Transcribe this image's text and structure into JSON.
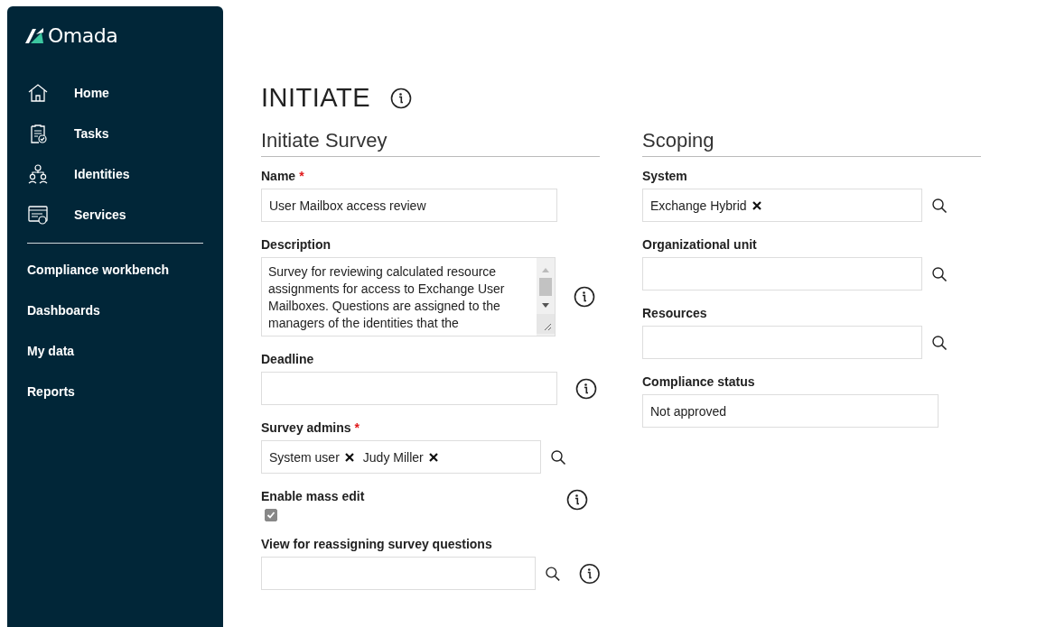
{
  "sidebar": {
    "logo": "Omada",
    "items": [
      {
        "label": "Home",
        "selected": false
      },
      {
        "label": "Tasks",
        "selected": false
      },
      {
        "label": "Identities",
        "selected": false
      },
      {
        "label": "Services",
        "selected": false
      }
    ],
    "links": [
      {
        "label": "Compliance workbench"
      },
      {
        "label": "Dashboards"
      },
      {
        "label": "My data"
      },
      {
        "label": "Reports"
      }
    ]
  },
  "page": {
    "title": "INITIATE",
    "info": true
  },
  "sections": [
    {
      "title": "Initiate Survey",
      "fields": [
        {
          "kind": "text",
          "label": "Name",
          "required_mark": "*",
          "value": "User Mailbox access review",
          "info": false,
          "search": false
        },
        {
          "kind": "textarea",
          "label": "Description",
          "value": "Survey for reviewing calculated resource assignments for access to Exchange User Mailboxes. Questions are assigned to the managers of the identities that the",
          "info": true,
          "search": false
        },
        {
          "kind": "text",
          "label": "Deadline",
          "info": true,
          "search": false
        },
        {
          "kind": "tags",
          "label": "Survey admins",
          "required_mark": "*",
          "tags": [
            "System user",
            "Judy Miller"
          ],
          "info": false,
          "search": true
        },
        {
          "kind": "checkbox",
          "label": "Enable mass edit",
          "checked": true,
          "disabled": true,
          "info": true,
          "search": false
        },
        {
          "kind": "text",
          "label": "View for reassigning survey questions",
          "info": true,
          "search": true
        }
      ]
    },
    {
      "title": "Scoping",
      "fields": [
        {
          "kind": "tags",
          "label": "System",
          "tags": [
            "Exchange Hybrid"
          ],
          "info": false,
          "search": true
        },
        {
          "kind": "text",
          "label": "Organizational unit",
          "info": false,
          "search": true
        },
        {
          "kind": "text",
          "label": "Resources",
          "info": false,
          "search": true
        },
        {
          "kind": "text",
          "label": "Compliance status",
          "value": "Not approved",
          "info": false,
          "search": false
        }
      ]
    }
  ]
}
